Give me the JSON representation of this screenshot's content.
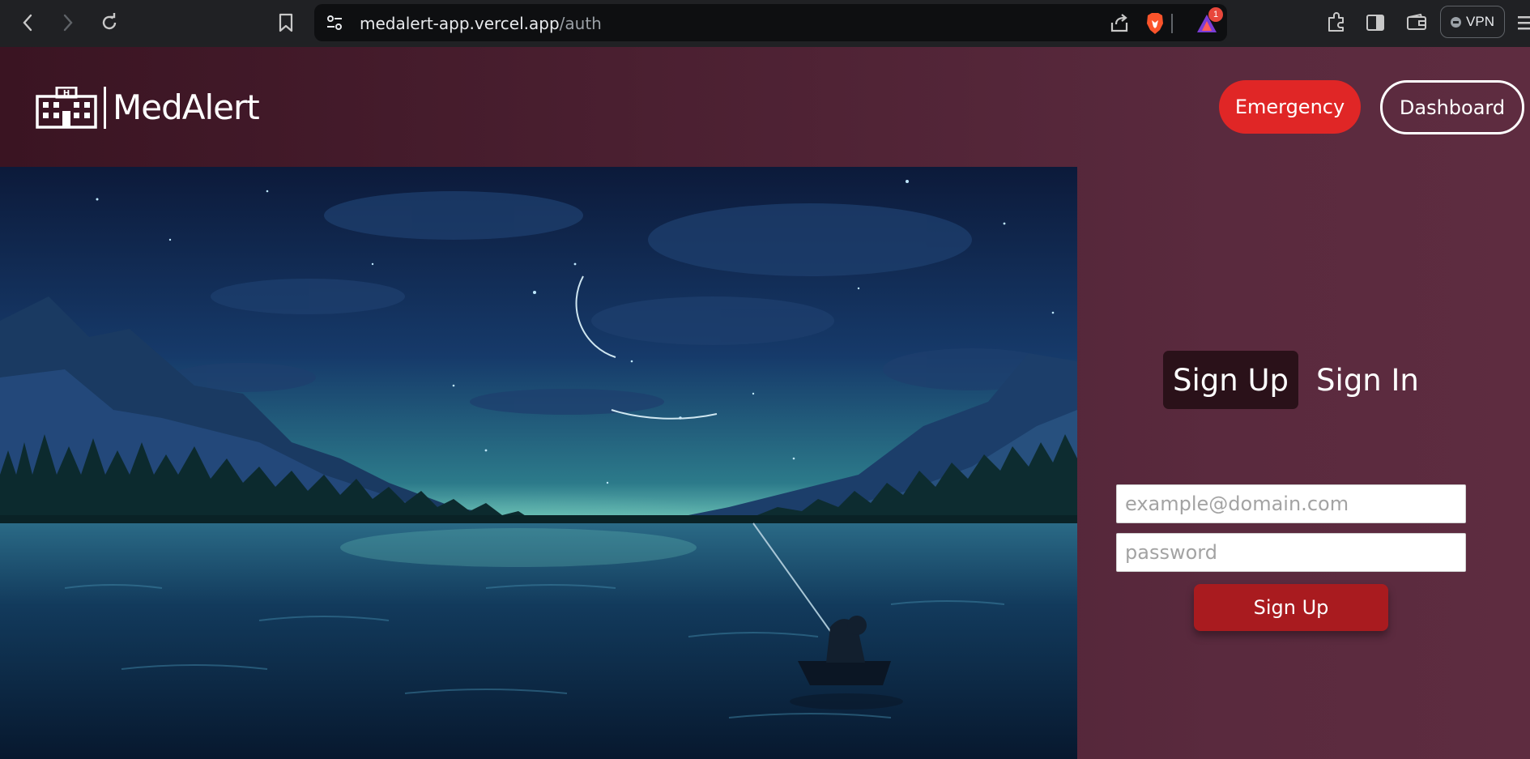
{
  "browser": {
    "url_host": "medalert-app.vercel.app",
    "url_path": "/auth",
    "vpn_label": "VPN",
    "notification_count": "1",
    "icons": [
      "back-icon",
      "forward-icon",
      "reload-icon",
      "bookmark-icon",
      "site-info-icon",
      "share-icon",
      "brave-shield-icon",
      "brave-rewards-icon",
      "extensions-icon",
      "sidebar-icon",
      "wallet-icon",
      "menu-icon"
    ]
  },
  "header": {
    "logo_text": "MedAlert",
    "logo_icon": "hospital-icon",
    "emergency_label": "Emergency",
    "dashboard_label": "Dashboard"
  },
  "hero": {
    "icon": "night-lake-illustration"
  },
  "auth": {
    "tabs": [
      {
        "label": "Sign Up",
        "active": true
      },
      {
        "label": "Sign In",
        "active": false
      }
    ],
    "email_placeholder": "example@domain.com",
    "email_value": "",
    "password_placeholder": "password",
    "password_value": "",
    "submit_label": "Sign Up"
  },
  "colors": {
    "emergency": "#e02626",
    "submit": "#a91b1f",
    "active_tab": "#2a1119",
    "page_bg": "#5a2a3e"
  }
}
